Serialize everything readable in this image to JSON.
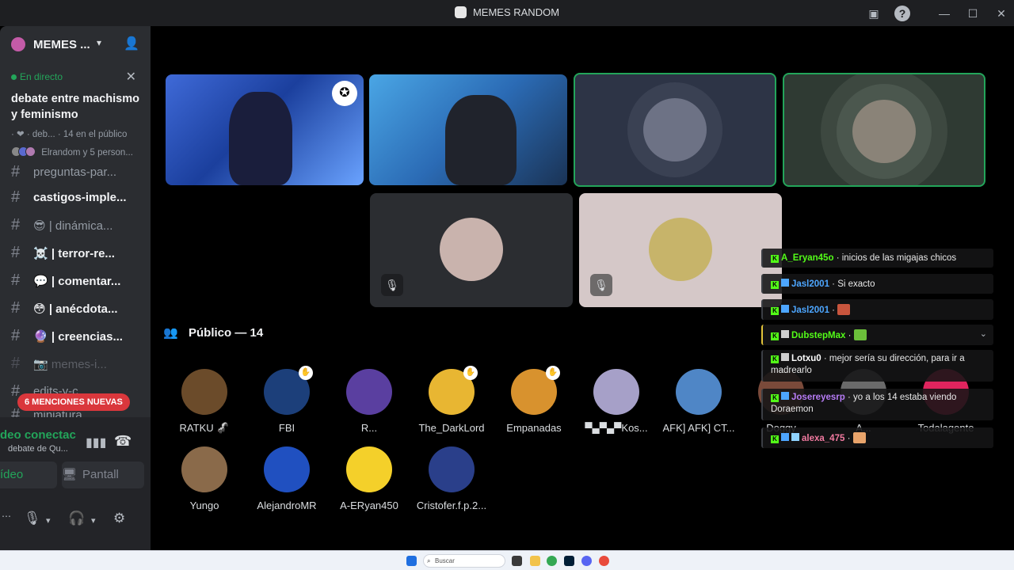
{
  "window": {
    "title": "MEMES RANDOM",
    "buttons": {
      "inbox": "▣",
      "help": "?",
      "minimize": "—",
      "maximize": "☐",
      "close": "✕"
    }
  },
  "sidebar": {
    "server_name": "MEMES ...",
    "live": {
      "label": "En directo",
      "title": "debate entre machismo y feminismo",
      "meta": "· ❤ · deb... · 14 en el público",
      "listeners": "Elrandom y 5 person..."
    },
    "channels": [
      {
        "emoji": "",
        "name": "preguntas-par..."
      },
      {
        "emoji": "",
        "name": "castigos-imple..."
      },
      {
        "emoji": "😎",
        "name": "| dinámica..."
      },
      {
        "emoji": "☠️",
        "name": "| terror-re..."
      },
      {
        "emoji": "💬",
        "name": "| comentar..."
      },
      {
        "emoji": "😳",
        "name": "| anécdota..."
      },
      {
        "emoji": "🔮",
        "name": "| creencias..."
      },
      {
        "emoji": "📷",
        "name": "memes-i..."
      },
      {
        "emoji": "",
        "name": "edits-y-c..."
      },
      {
        "emoji": "",
        "name": "miniatura..."
      }
    ],
    "mentions_pill": "6 MENCIONES NUEVAS",
    "voice": {
      "status": "deo conectac",
      "subtitle": "debate de Qu...",
      "video_btn": "ídeo",
      "screen_btn": "Pantall"
    }
  },
  "stage": {
    "audience_header": "Público — 14",
    "audience": [
      {
        "name": "RATKU 🦨",
        "color": "#6b4b2a",
        "hand": false
      },
      {
        "name": "FBI",
        "color": "#1c3f7a",
        "hand": true
      },
      {
        "name": "R...",
        "color": "#5a3fa0",
        "hand": false
      },
      {
        "name": "The_DarkLord",
        "color": "#e8b632",
        "hand": true
      },
      {
        "name": "Empanadas",
        "color": "#d8922e",
        "hand": true
      },
      {
        "name": "▀▄▀▄▀Kos...",
        "color": "#a6a0c8",
        "hand": false
      },
      {
        "name": "AFK] AFK] CT...",
        "color": "#4f86c6",
        "hand": false
      },
      {
        "name": "Doggy",
        "color": "#7a4a3a",
        "hand": false
      },
      {
        "name": "A...",
        "color": "#6a6a6a",
        "hand": false
      },
      {
        "name": "Todalagente",
        "color": "#e0245e",
        "hand": false
      },
      {
        "name": "Yungo",
        "color": "#8a6a4a",
        "hand": false
      },
      {
        "name": "AlejandroMR",
        "color": "#2050c0",
        "hand": false
      },
      {
        "name": "A-ERyan450",
        "color": "#f4d02a",
        "hand": false
      },
      {
        "name": "Cristofer.f.p.2...",
        "color": "#2a3f8a",
        "hand": false
      }
    ]
  },
  "chat": [
    {
      "user": "A_Eryan45o",
      "user_color": "#53fc18",
      "text": "· inicios de las migajas chicos",
      "badges": [
        "k"
      ]
    },
    {
      "user": "Jasl2001",
      "user_color": "#4da6ff",
      "text": "· Si exacto",
      "badges": [
        "k",
        "b"
      ]
    },
    {
      "user": "Jasl2001",
      "user_color": "#4da6ff",
      "text": "·",
      "badges": [
        "k",
        "b"
      ],
      "emote": "#c8553d"
    },
    {
      "user": "DubstepMax",
      "user_color": "#53fc18",
      "text": "·",
      "badges": [
        "k",
        "b"
      ],
      "emote": "#6bbf3a"
    },
    {
      "user": "Lotxu0",
      "user_color": "#ffffff",
      "text": "· mejor sería su dirección, para ir a madrearlo",
      "badges": [
        "k",
        "b"
      ]
    },
    {
      "user": "Josereyesrp",
      "user_color": "#b77cf6",
      "text": "· yo a los 14 estaba viendo Doraemon",
      "badges": [
        "k",
        "b"
      ]
    },
    {
      "user": "alexa_475",
      "user_color": "#f27aa0",
      "text": "·",
      "badges": [
        "k",
        "b",
        "b"
      ],
      "emote": "#e9a46b"
    }
  ],
  "taskbar": {
    "search_placeholder": "Buscar"
  }
}
